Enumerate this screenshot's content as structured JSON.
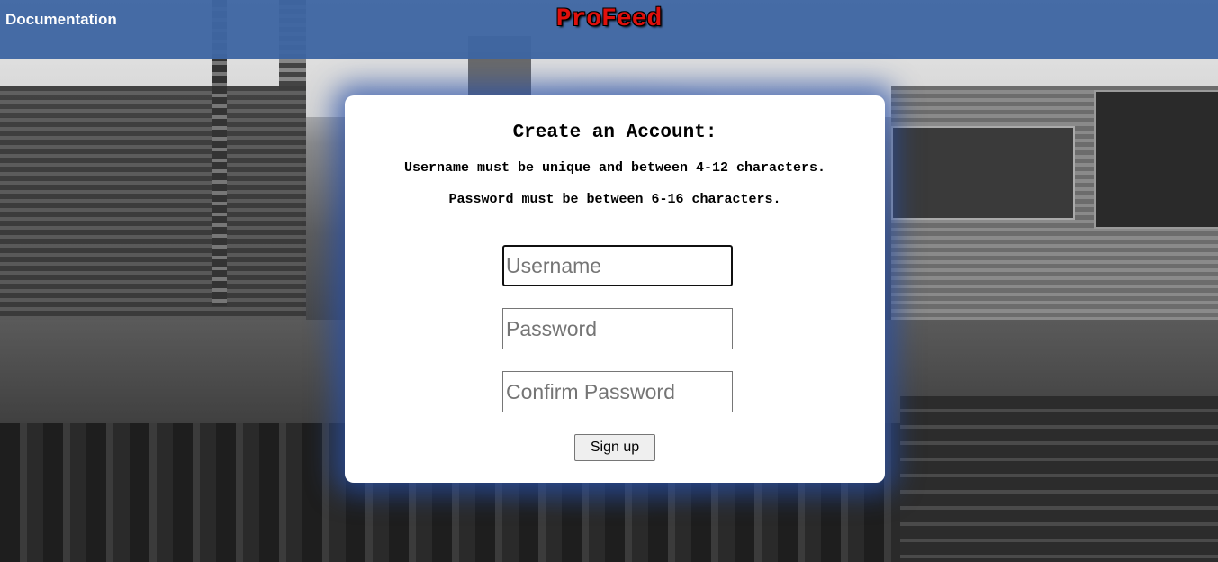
{
  "header": {
    "documentation_link": "Documentation",
    "brand": "ProFeed",
    "brand_color": "#e0100c",
    "bar_color": "#3e66a2"
  },
  "form": {
    "title": "Create an Account:",
    "rule_username": "Username must be unique and between 4-12 characters.",
    "rule_password": "Password must be between 6-16 characters.",
    "username_placeholder": "Username",
    "password_placeholder": "Password",
    "confirm_placeholder": "Confirm Password",
    "signup_label": "Sign up"
  }
}
